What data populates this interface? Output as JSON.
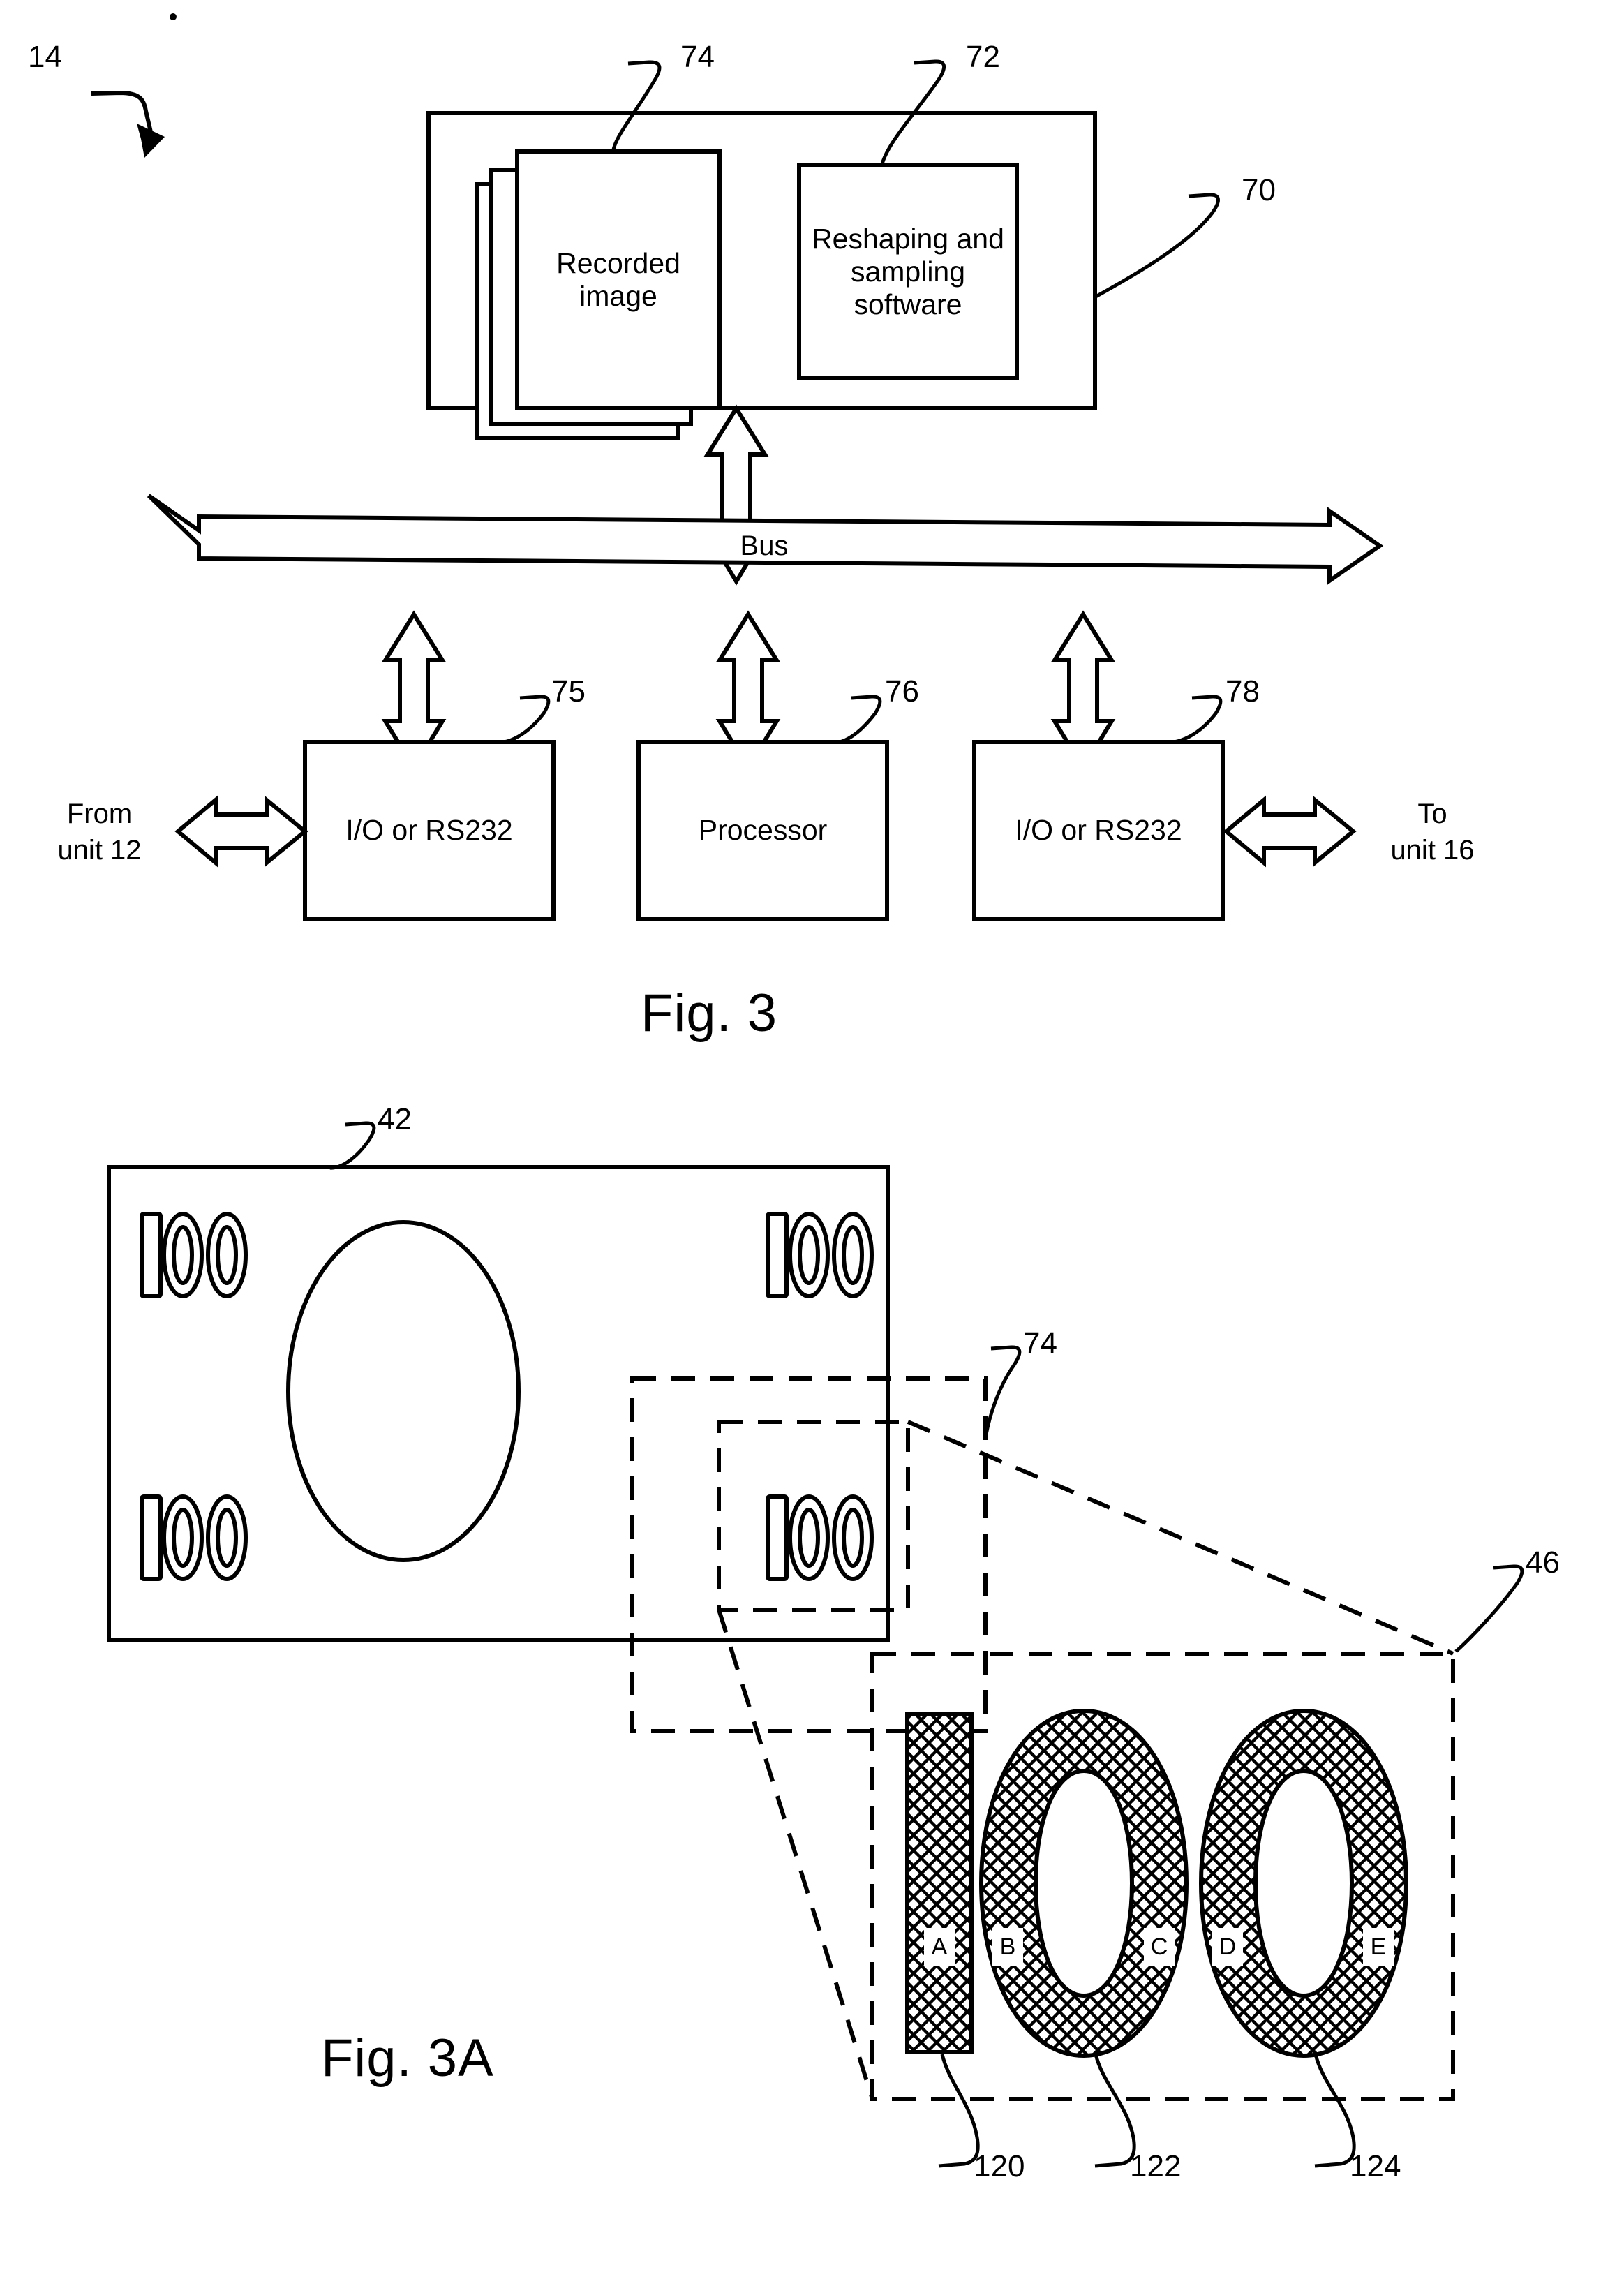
{
  "figure3": {
    "system_ref": "14",
    "memory_block": {
      "ref": "70",
      "recorded_image": {
        "ref": "74",
        "label": "Recorded\nimage"
      },
      "software": {
        "ref": "72",
        "label": "Reshaping and\nsampling\nsoftware"
      }
    },
    "bus": {
      "label": "Bus"
    },
    "modules": [
      {
        "ref": "75",
        "label": "I/O or RS232"
      },
      {
        "ref": "76",
        "label": "Processor"
      },
      {
        "ref": "78",
        "label": "I/O or RS232"
      }
    ],
    "left_port": {
      "label": "From\nunit 12"
    },
    "right_port": {
      "label": "To\nunit 16"
    },
    "caption": "Fig. 3"
  },
  "figure3a": {
    "caption": "Fig. 3A",
    "banknote": {
      "ref": "42",
      "denomination": "100",
      "corner_count": 4
    },
    "crop_region_ref": "74",
    "detail_region_ref": "46",
    "detail": {
      "denomination": "100",
      "sample_labels": [
        "A",
        "B",
        "C",
        "D",
        "E"
      ],
      "element_refs": [
        "120",
        "122",
        "124"
      ]
    }
  },
  "style": {
    "ink": "#000000",
    "paper": "#ffffff"
  }
}
